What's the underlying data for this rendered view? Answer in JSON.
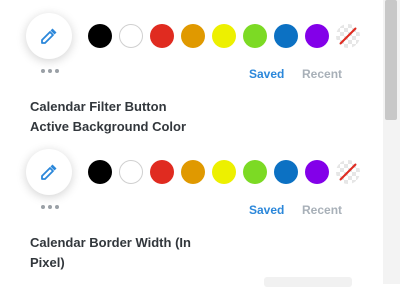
{
  "palette": {
    "colors": [
      "#000000",
      "#ffffff",
      "#e02b20",
      "#e09900",
      "#edf000",
      "#7cda24",
      "#0c71c3",
      "#8300e9"
    ],
    "none_color": "transparent",
    "accent": "#2b87da"
  },
  "sections": [
    {
      "tabs": {
        "saved": "Saved",
        "recent": "Recent"
      },
      "label_line1": "Calendar Filter Button",
      "label_line2": "Active Background Color"
    },
    {
      "tabs": {
        "saved": "Saved",
        "recent": "Recent"
      },
      "label_line1": "Calendar Border Width (In",
      "label_line2": "Pixel)"
    }
  ],
  "icons": {
    "picker": "eyedropper-icon",
    "more": "more-dots-icon",
    "none": "no-color-icon"
  }
}
